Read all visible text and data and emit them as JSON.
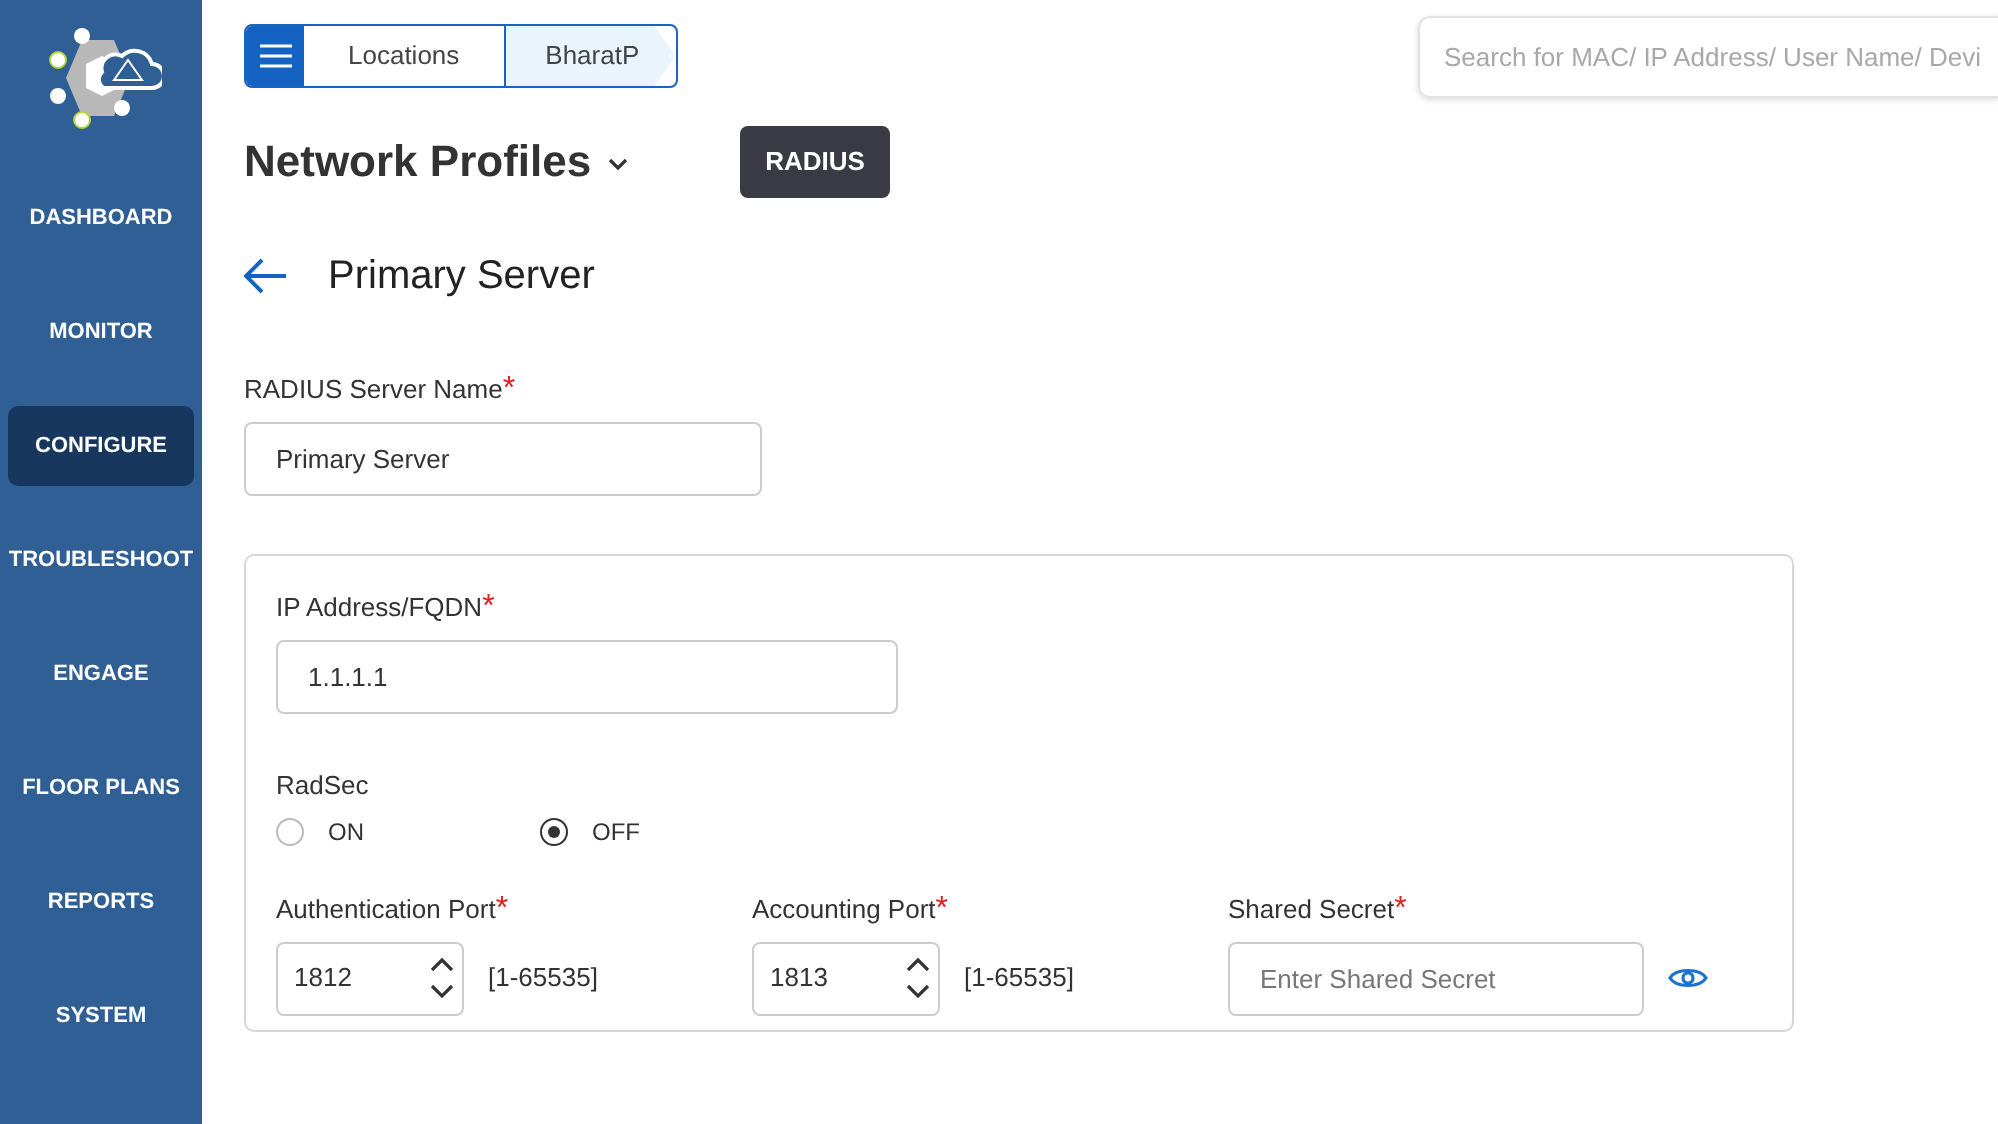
{
  "sidebar": {
    "items": [
      {
        "label": "DASHBOARD",
        "selected": false
      },
      {
        "label": "MONITOR",
        "selected": false
      },
      {
        "label": "CONFIGURE",
        "selected": true
      },
      {
        "label": "TROUBLESHOOT",
        "selected": false
      },
      {
        "label": "ENGAGE",
        "selected": false
      },
      {
        "label": "FLOOR PLANS",
        "selected": false
      },
      {
        "label": "REPORTS",
        "selected": false
      },
      {
        "label": "SYSTEM",
        "selected": false
      }
    ]
  },
  "breadcrumb": [
    "Locations",
    "BharatP"
  ],
  "search": {
    "placeholder": "Search for MAC/ IP Address/ User Name/ Devi"
  },
  "page_title": "Network Profiles",
  "badge": "RADIUS",
  "section_title": "Primary Server",
  "server_name": {
    "label": "RADIUS Server Name",
    "required_mark": "*",
    "value": "Primary Server"
  },
  "ip": {
    "label": "IP Address/FQDN",
    "required_mark": "*",
    "value": "1.1.1.1"
  },
  "radsec": {
    "label": "RadSec",
    "options": [
      {
        "label": "ON",
        "selected": false
      },
      {
        "label": "OFF",
        "selected": true
      }
    ]
  },
  "ports": [
    {
      "label": "Authentication Port",
      "required_mark": "*",
      "value": "1812",
      "range": "[1-65535]"
    },
    {
      "label": "Accounting Port",
      "required_mark": "*",
      "value": "1813",
      "range": "[1-65535]"
    }
  ],
  "shared_secret": {
    "label": "Shared Secret",
    "required_mark": "*",
    "placeholder": "Enter Shared Secret"
  }
}
